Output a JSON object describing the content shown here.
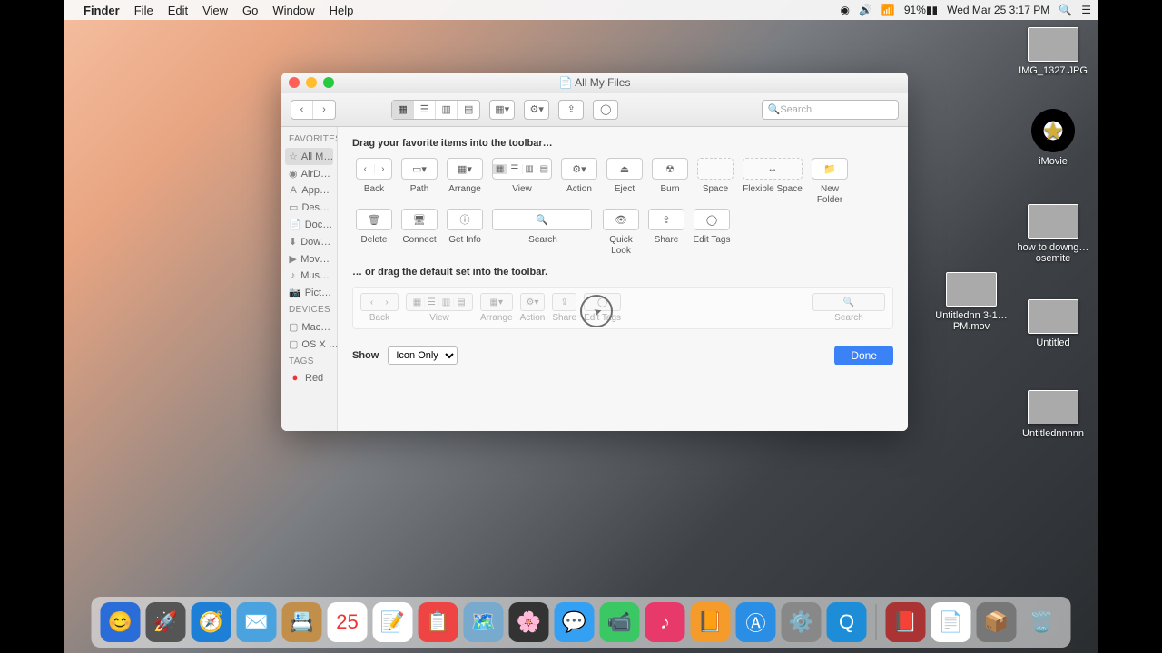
{
  "menubar": {
    "app": "Finder",
    "items": [
      "File",
      "Edit",
      "View",
      "Go",
      "Window",
      "Help"
    ],
    "battery": "91%",
    "clock": "Wed Mar 25  3:17 PM"
  },
  "desktop": {
    "icons": [
      {
        "label": "IMG_1327.JPG",
        "kind": "thumb"
      },
      {
        "label": "iMovie",
        "kind": "star"
      },
      {
        "label": "how to downg…osemite",
        "kind": "thumb"
      },
      {
        "label": "Untitlednn 3-1…PM.mov",
        "kind": "thumb"
      },
      {
        "label": "Untitled",
        "kind": "thumb"
      },
      {
        "label": "Untitlednnnnn",
        "kind": "thumb"
      }
    ]
  },
  "finder": {
    "title": "All My Files",
    "toolbar_search_placeholder": "Search",
    "sidebar": {
      "favorites_hdr": "Favorites",
      "favorites": [
        "All M…",
        "AirD…",
        "App…",
        "Des…",
        "Doc…",
        "Dow…",
        "Mov…",
        "Mus…",
        "Pict…"
      ],
      "devices_hdr": "Devices",
      "devices": [
        "Mac…",
        "OS X …"
      ],
      "tags_hdr": "Tags",
      "tags": [
        "Red"
      ]
    },
    "customize": {
      "lead": "Drag your favorite items into the toolbar…",
      "row1": [
        "Back",
        "Path",
        "Arrange",
        "View",
        "Action",
        "Eject",
        "Burn",
        "Space",
        "Flexible Space"
      ],
      "row2": [
        "New Folder",
        "Delete",
        "Connect",
        "Get Info",
        "Search",
        "Quick Look",
        "Share",
        "Edit Tags"
      ],
      "default_lead": "… or drag the default set into the toolbar.",
      "default_items": [
        "Back",
        "View",
        "Arrange",
        "Action",
        "Share",
        "Edit Tags",
        "Search"
      ],
      "show_label": "Show",
      "show_value": "Icon Only",
      "done": "Done"
    }
  },
  "dock": {
    "apps": [
      "🔵",
      "🚀",
      "🧭",
      "📬",
      "📇",
      "📅",
      "📝",
      "📕",
      "🗺️",
      "📷",
      "💬",
      "📞",
      "🎵",
      "📙",
      "🛒",
      "⚙️",
      "🔵"
    ],
    "right": [
      "📄",
      "📁",
      "📦",
      "🗑️"
    ]
  }
}
